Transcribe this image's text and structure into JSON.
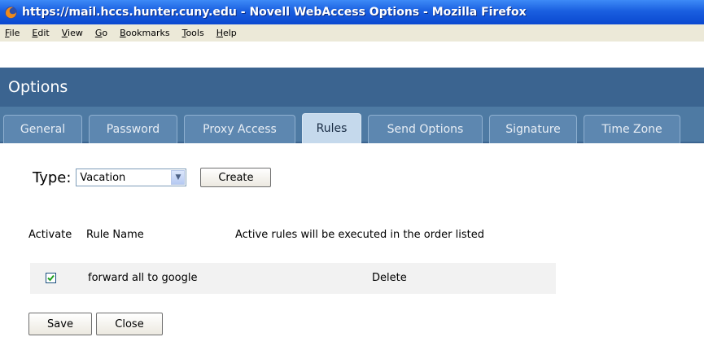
{
  "window": {
    "title": "https://mail.hccs.hunter.cuny.edu - Novell WebAccess Options - Mozilla Firefox"
  },
  "menubar": {
    "items": [
      {
        "label": "File",
        "mnemonic": "F"
      },
      {
        "label": "Edit",
        "mnemonic": "E"
      },
      {
        "label": "View",
        "mnemonic": "V"
      },
      {
        "label": "Go",
        "mnemonic": "G"
      },
      {
        "label": "Bookmarks",
        "mnemonic": "B"
      },
      {
        "label": "Tools",
        "mnemonic": "T"
      },
      {
        "label": "Help",
        "mnemonic": "H"
      }
    ]
  },
  "header": {
    "title": "Options"
  },
  "tabs": [
    {
      "label": "General"
    },
    {
      "label": "Password"
    },
    {
      "label": "Proxy Access"
    },
    {
      "label": "Rules",
      "active": true
    },
    {
      "label": "Send Options"
    },
    {
      "label": "Signature"
    },
    {
      "label": "Time Zone"
    }
  ],
  "type_selector": {
    "label": "Type:",
    "selected": "Vacation",
    "create_label": "Create"
  },
  "rules_list": {
    "columns": {
      "activate": "Activate",
      "rule_name": "Rule Name",
      "note": "Active rules will be executed in the order listed"
    },
    "rows": [
      {
        "active": true,
        "name": "forward all to google",
        "delete_label": "Delete"
      }
    ]
  },
  "actions": {
    "save_label": "Save",
    "close_label": "Close"
  },
  "colors": {
    "titlebar": "#1a5fe0",
    "menubar": "#ece9d8",
    "options_header": "#3b6490",
    "tab_strip": "#4e7aa3",
    "active_tab": "#c5d9ec",
    "rule_row_bg": "#f2f2f2"
  }
}
